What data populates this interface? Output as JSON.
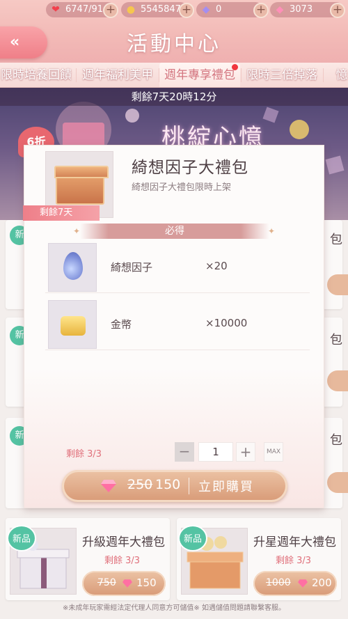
{
  "resources": [
    {
      "icon": "heart-icon",
      "value": "6747/91"
    },
    {
      "icon": "cat-coin-icon",
      "value": "5545847"
    },
    {
      "icon": "purple-gem-icon",
      "value": "0"
    },
    {
      "icon": "pink-gem-icon",
      "value": "3073"
    }
  ],
  "header": {
    "title": "活動中心",
    "back_label": "«"
  },
  "tabs": [
    {
      "label": "限時培養回饋"
    },
    {
      "label": "週年福利美甲"
    },
    {
      "label": "週年專享禮包"
    },
    {
      "label": "限時三倍掉落"
    },
    {
      "label": "憶"
    }
  ],
  "banner": {
    "countdown": "剩餘7天20時12分",
    "title": "桃綻心憶",
    "discount": "6折"
  },
  "modal": {
    "title": "綺想因子大禮包",
    "subtitle": "綺想因子大禮包限時上架",
    "remain_ribbon": "剩餘7天",
    "must_label": "必得",
    "items": [
      {
        "name": "綺想因子",
        "qty": "×20"
      },
      {
        "name": "金幣",
        "qty": "×10000"
      }
    ],
    "stock": "剩餘 3/3",
    "quantity": {
      "minus": "−",
      "value": "1",
      "plus": "+",
      "max": "MAX"
    },
    "buy": {
      "old_price": "250",
      "new_price": "150",
      "label": "立即購買"
    }
  },
  "background_cards": [
    {
      "new_tag": "新",
      "side_text": "包"
    },
    {
      "new_tag": "新",
      "side_text": "包"
    },
    {
      "new_tag": "新",
      "side_text": "包"
    }
  ],
  "bottom_cards": [
    {
      "new_tag": "新品",
      "name": "升級週年大禮包",
      "remain": "剩餘 3/3",
      "old_price": "750",
      "new_price": "150"
    },
    {
      "new_tag": "新品",
      "name": "升星週年大禮包",
      "remain": "剩餘 3/3",
      "old_price": "1000",
      "new_price": "200"
    }
  ],
  "footer_note": "※未成年玩家需經法定代理人同意方可儲值※ 如遇儲值問題請聯繫客服。",
  "colors": {
    "accent_pink": "#ef7f88",
    "new_tag_green": "#54c3a3",
    "buy_gold": "#d89a77"
  }
}
